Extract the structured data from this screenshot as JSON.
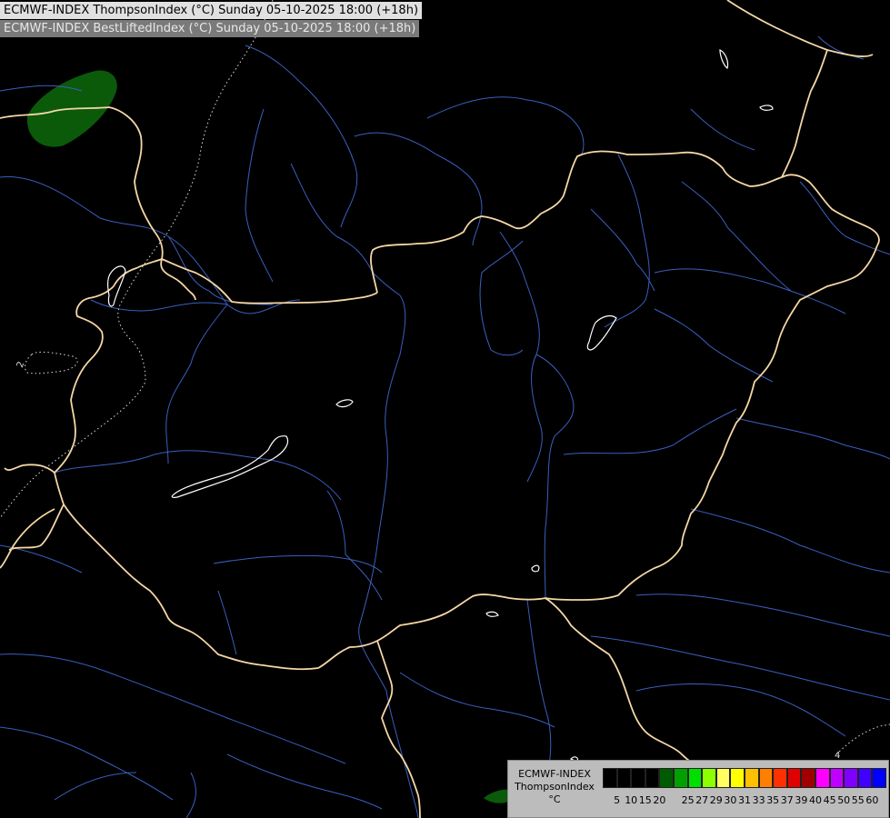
{
  "header": {
    "line1": "ECMWF-INDEX ThompsonIndex (°C) Sunday 05-10-2025 18:00 (+18h)",
    "line2": "ECMWF-INDEX BestLiftedIndex (°C) Sunday 05-10-2025 18:00 (+18h)"
  },
  "map": {
    "background_color": "#000000",
    "border_color": "#f5d7a6",
    "river_color": "#3a5fbf",
    "lake_color": "#ffffff",
    "contour_label": "2",
    "contour_label_right": "4"
  },
  "legend": {
    "label_line1": "ECMWF-INDEX",
    "label_line2": "ThompsonIndex",
    "label_line3": "°C",
    "colors": [
      "#000000",
      "#000000",
      "#000000",
      "#000000",
      "#005a00",
      "#00a000",
      "#00e000",
      "#8cff00",
      "#ffff60",
      "#ffff00",
      "#ffc000",
      "#ff8000",
      "#ff3000",
      "#e00000",
      "#a00000",
      "#ff00ff",
      "#c000ff",
      "#8000ff",
      "#4000ff",
      "#0000ff"
    ],
    "ticks": [
      "5",
      "10",
      "15",
      "20",
      "25",
      "27",
      "29",
      "30",
      "31",
      "33",
      "35",
      "37",
      "39",
      "40",
      "45",
      "50",
      "55",
      "60"
    ]
  }
}
